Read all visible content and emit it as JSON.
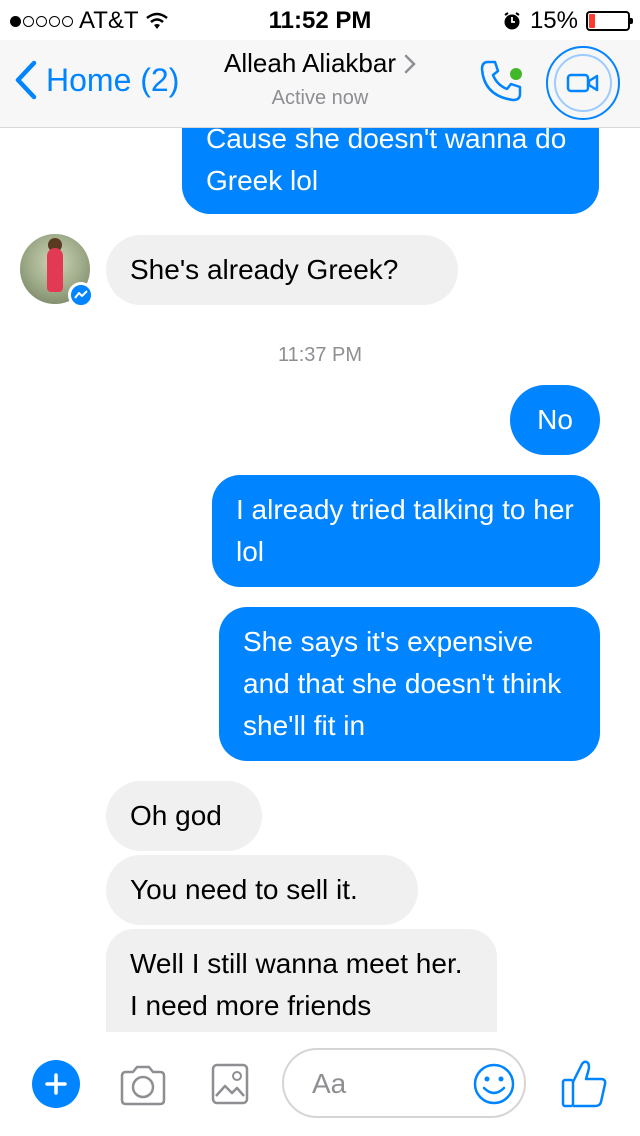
{
  "status_bar": {
    "carrier": "AT&T",
    "time": "11:52 PM",
    "battery_percent": "15%",
    "battery_level": 0.15
  },
  "nav": {
    "back_label": "Home (2)",
    "contact_name": "Alleah Aliakbar",
    "status": "Active now",
    "accent_color": "#0084ff"
  },
  "messages": [
    {
      "from": "me",
      "text": "Cause she doesn't wanna do Greek lol"
    },
    {
      "from": "them",
      "text": "She's already Greek?"
    },
    {
      "type": "timestamp",
      "text": "11:37 PM"
    },
    {
      "from": "me",
      "text": "No"
    },
    {
      "from": "me",
      "text": "I already tried talking to her lol"
    },
    {
      "from": "me",
      "text": "She says it's expensive and that she doesn't think she'll fit in"
    },
    {
      "from": "them",
      "text": "Oh god"
    },
    {
      "from": "them",
      "text": "You need to sell it."
    },
    {
      "from": "them",
      "text": "Well I still wanna meet her. I need more friends"
    }
  ],
  "composer": {
    "placeholder": "Aa",
    "icons": [
      "plus-icon",
      "camera-icon",
      "gallery-icon",
      "emoji-icon",
      "thumbs-up-icon"
    ]
  }
}
